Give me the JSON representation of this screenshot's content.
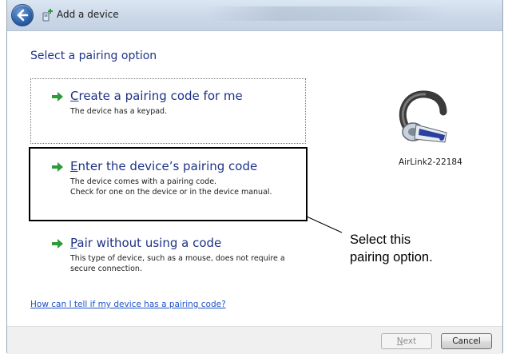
{
  "window": {
    "title": "Add a device"
  },
  "heading": "Select a pairing option",
  "options": [
    {
      "title_accel": "C",
      "title_rest": "reate a pairing code for me",
      "desc": [
        "The device has a keypad."
      ]
    },
    {
      "title_accel": "E",
      "title_rest": "nter the device’s pairing code",
      "desc": [
        "The device comes with a pairing code.",
        "Check for one on the device or in the device manual."
      ]
    },
    {
      "title_accel": "P",
      "title_rest": "air without using a code",
      "desc": [
        "This type of device, such as a mouse, does not require a",
        "secure connection."
      ]
    }
  ],
  "device": {
    "name": "AirLink2-22184",
    "icon": "bluetooth-headset-icon"
  },
  "callout": {
    "line1": "Select this",
    "line2": "pairing option."
  },
  "help_link": "How can I tell if my device has a pairing code?",
  "buttons": {
    "next_accel": "N",
    "next_rest": "ext",
    "cancel": "Cancel"
  },
  "colors": {
    "accent_text": "#1e3287",
    "link": "#1e52c6",
    "arrow_green": "#2e9a3a"
  }
}
